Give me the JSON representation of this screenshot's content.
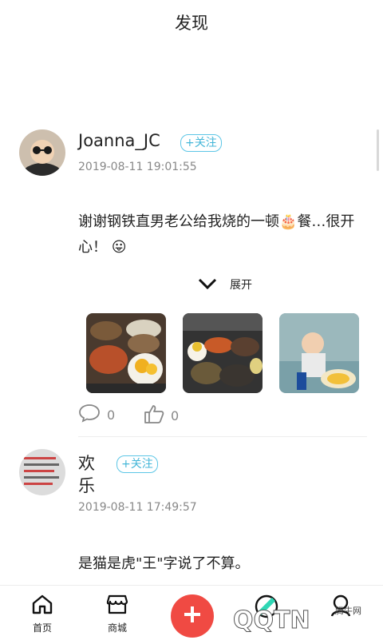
{
  "header": {
    "title": "发现"
  },
  "posts": [
    {
      "username": "Joanna_JC",
      "follow_label": "+关注",
      "timestamp": "2019-08-11 19:01:55",
      "content": "谢谢钢铁直男老公给我烧的一顿🎂餐…很开心！ 😛",
      "expand_label": "展开",
      "comments": "0",
      "likes": "0"
    },
    {
      "username": "欢乐",
      "follow_label": "+关注",
      "timestamp": "2019-08-11 17:49:57",
      "content": "是猫是虎\"王\"字说了不算。"
    }
  ],
  "tabbar": {
    "items": [
      {
        "label": "首页",
        "icon": "home-icon"
      },
      {
        "label": "商城",
        "icon": "shop-icon"
      }
    ],
    "fab_icon": "plus-icon"
  },
  "watermark": {
    "text": "腾牛网",
    "logo_text": "QQTN"
  },
  "colors": {
    "accent": "#5cc6e6",
    "fab": "#f04a43",
    "muted": "#888888"
  }
}
